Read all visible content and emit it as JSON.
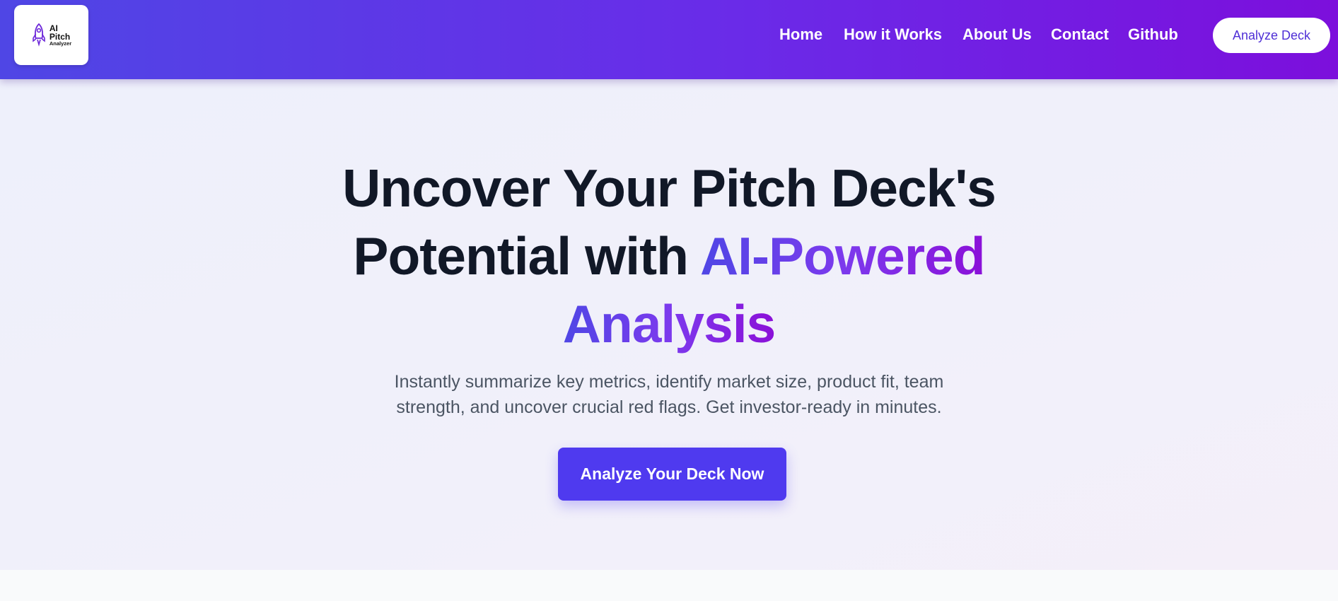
{
  "logo": {
    "line1": "AI",
    "line2": "Pitch",
    "line3": "Analyzer",
    "icon": "rocket-icon"
  },
  "nav": {
    "links": [
      "Home",
      "How it Works",
      "About Us",
      "Contact",
      "Github"
    ],
    "cta_label": "Analyze Deck"
  },
  "hero": {
    "title_part1": "Uncover Your Pitch Deck's",
    "title_part2": "Potential with ",
    "title_highlight_1": "AI-Powered",
    "title_highlight_2": "Analysis",
    "subtitle_line1": "Instantly summarize key metrics, identify market size, product fit, team",
    "subtitle_line2": "strength, and uncover crucial red flags. Get investor-ready in minutes.",
    "cta_label": "Analyze Your Deck Now"
  },
  "colors": {
    "nav_gradient_start": "#4f46e5",
    "nav_gradient_end": "#7c0fdc",
    "accent": "#4f3aef",
    "title_text": "#111827",
    "body_text": "#4b5563",
    "hero_background": "#eef0fb"
  }
}
